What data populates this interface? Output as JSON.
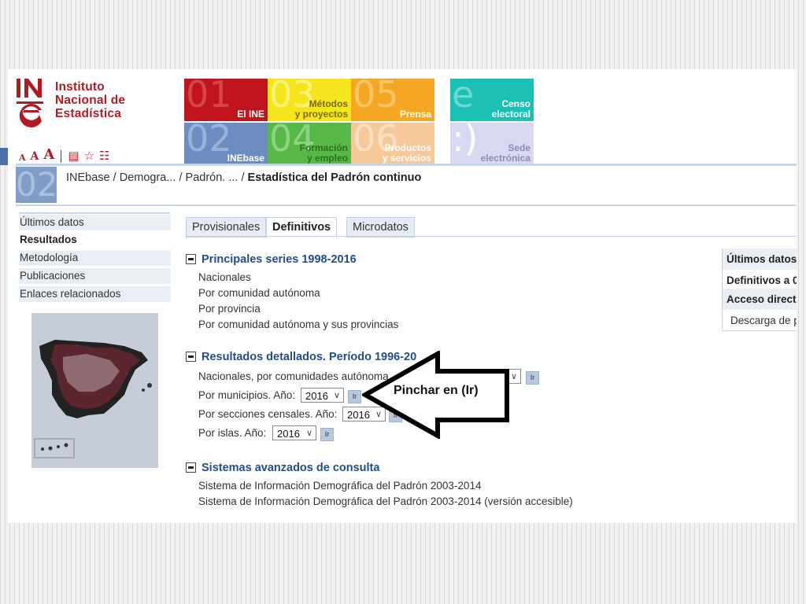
{
  "logo": {
    "mark_text": "INe",
    "lines": [
      "Instituto",
      "Nacional de",
      "Estadística"
    ],
    "brand_color": "#b01c24"
  },
  "toolbar": {
    "font_small": "A",
    "font_medium": "A",
    "font_large": "A",
    "icons": [
      "document-icon",
      "star-icon",
      "sitemap-icon"
    ]
  },
  "tiles": [
    {
      "num": "01",
      "label": "El INE",
      "bg": "#c0141f",
      "num_color": "#d8444c",
      "label_color": "#ffffff"
    },
    {
      "num": "03",
      "label": "Métodos\ny proyectos",
      "bg": "#f5e51c",
      "num_color": "#fbf27a",
      "label_color": "#7a6a00"
    },
    {
      "num": "05",
      "label": "Prensa",
      "bg": "#f5a623",
      "num_color": "#fcc565",
      "label_color": "#ffffff"
    },
    {
      "num": "e",
      "label": "Censo\nelectoral",
      "bg": "#1cbfb4",
      "num_color": "#6ed9d1",
      "label_color": "#ffffff"
    },
    {
      "num": "02",
      "label": "INEbase",
      "bg": "#6d8cc0",
      "num_color": "#9bb2d8",
      "label_color": "#ffffff"
    },
    {
      "num": "04",
      "label": "Formación\ny empleo",
      "bg": "#57b847",
      "num_color": "#8fd483",
      "label_color": "#2c6e22"
    },
    {
      "num": "06",
      "label": "Productos\ny servicios",
      "bg": "#f7c99a",
      "num_color": "#fbe0c4",
      "label_color": "#ffffff"
    },
    {
      "num": ":)",
      "label": "Sede\nelectrónica",
      "bg": "#d8d8f2",
      "num_color": "#ffffff",
      "label_color": "#8a8ab8"
    }
  ],
  "breadcrumb": {
    "box_num": "02",
    "items": [
      "INEbase",
      "Demogra...",
      "Padrón. ..."
    ],
    "current": "Estadística del Padrón continuo"
  },
  "sidebar": {
    "items": [
      {
        "label": "Últimos datos",
        "state": "shaded"
      },
      {
        "label": "Resultados",
        "state": "active"
      },
      {
        "label": "Metodología",
        "state": "shaded"
      },
      {
        "label": "Publicaciones",
        "state": "shaded"
      },
      {
        "label": "Enlaces relacionados",
        "state": "shaded"
      }
    ]
  },
  "tabs": [
    {
      "label": "Provisionales",
      "active": false
    },
    {
      "label": "Definitivos",
      "active": true
    },
    {
      "label": "Microdatos",
      "active": false
    }
  ],
  "sections": {
    "principales": {
      "title": "Principales series 1998-2016",
      "links": [
        "Nacionales",
        "Por comunidad autónoma",
        "Por provincia",
        "Por comunidad autónoma y sus provincias"
      ]
    },
    "detallados": {
      "title": "Resultados detallados. Período 1996-20",
      "rows": [
        {
          "label": "Nacionales, por comunidades autónoma",
          "year": ""
        },
        {
          "label": "Por municipios. Año:",
          "year": "2016"
        },
        {
          "label": "Por secciones censales. Año:",
          "year": "2016"
        },
        {
          "label": "Por islas. Año:",
          "year": "2016"
        }
      ],
      "go_label": "Ir"
    },
    "avanzados": {
      "title": "Sistemas avanzados de consulta",
      "links": [
        "Sistema de Información Demográfica del Padrón 2003-2014",
        "Sistema de Información Demográfica del Padrón 2003-2014 (versión accesible)"
      ]
    }
  },
  "right_box": {
    "items": [
      "Últimos datos",
      "Definitivos a 0",
      "Acceso directo",
      "Descarga de p"
    ]
  },
  "annotation": {
    "text": "Pinchar en (Ir)"
  }
}
